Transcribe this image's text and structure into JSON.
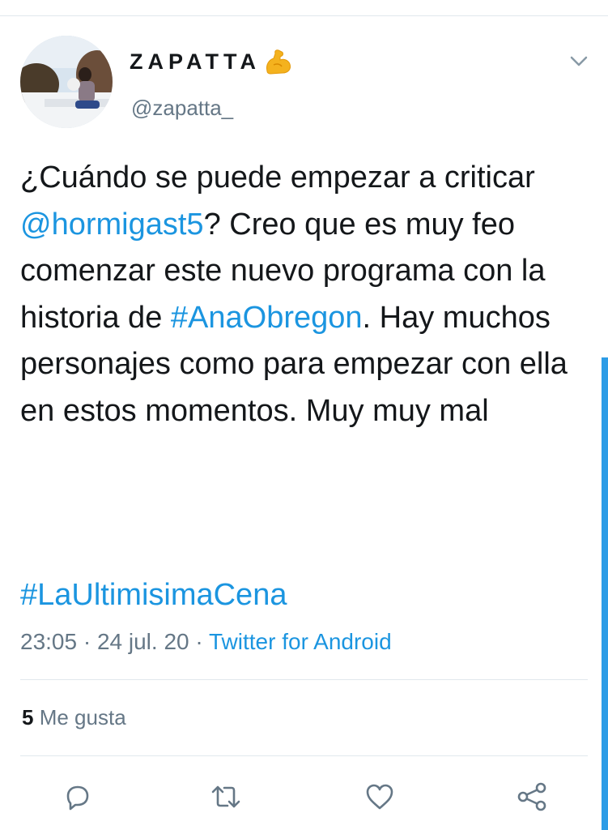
{
  "tweet": {
    "display_name": "ZAPATTA",
    "display_name_emoji": "flexed-biceps-icon",
    "username": "@zapatta_",
    "text_segments": [
      {
        "text": "¿Cuándo se puede empezar a criticar ",
        "link": false
      },
      {
        "text": "@hormigast5",
        "link": true
      },
      {
        "text": "? Creo que es muy feo comenzar este nuevo programa con la historia de ",
        "link": false
      },
      {
        "text": "#AnaObregon",
        "link": true
      },
      {
        "text": ". Hay muchos personajes como para empezar con ella en estos momentos. Muy muy mal",
        "link": false
      }
    ],
    "hashtag": "#LaUltimisimaCena",
    "time": "23:05",
    "date": "24 jul. 20",
    "separator": "·",
    "source": "Twitter for Android",
    "likes_count": "5",
    "likes_label": "Me gusta"
  },
  "colors": {
    "link": "#1b95e0",
    "secondary_text": "#657786",
    "divider": "#e1e8ed",
    "scrollbar": "#2d9ce6"
  },
  "actions": [
    {
      "name": "reply",
      "icon": "reply-icon"
    },
    {
      "name": "retweet",
      "icon": "retweet-icon"
    },
    {
      "name": "like",
      "icon": "heart-icon"
    },
    {
      "name": "share",
      "icon": "share-icon"
    }
  ]
}
